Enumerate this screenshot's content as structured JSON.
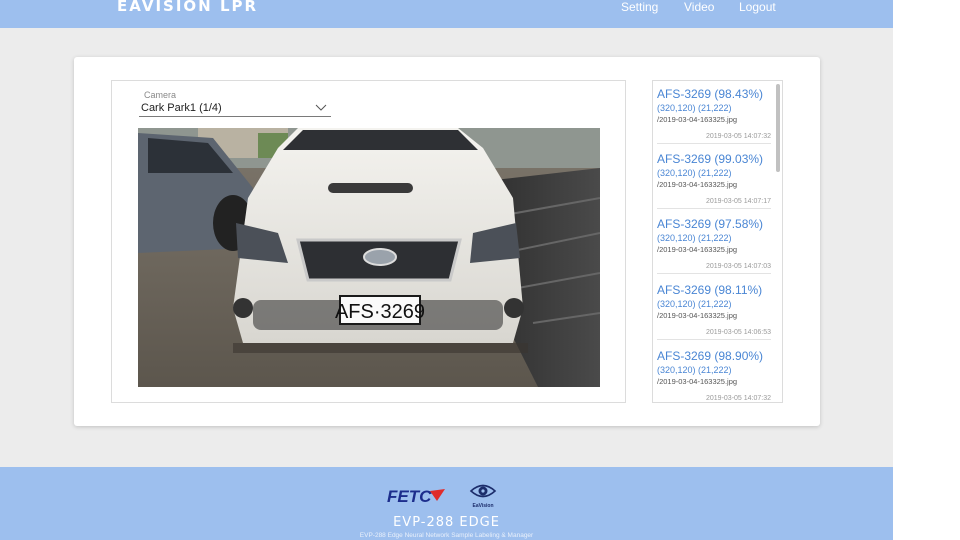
{
  "header": {
    "brand": "EAVISION LPR",
    "nav": [
      {
        "label": "Setting"
      },
      {
        "label": "Video"
      },
      {
        "label": "Logout"
      }
    ]
  },
  "camera": {
    "label": "Camera",
    "selected": "Cark Park1 (1/4)"
  },
  "video": {
    "plate_text": "AFS·3269"
  },
  "results": [
    {
      "plate": "AFS-3269 (98.43%)",
      "coords": "(320,120) (21,222)",
      "file": "/2019-03-04-163325.jpg",
      "timestamp": "2019-03-05 14:07:32"
    },
    {
      "plate": "AFS-3269 (99.03%)",
      "coords": "(320,120) (21,222)",
      "file": "/2019-03-04-163325.jpg",
      "timestamp": "2019-03-05 14:07:17"
    },
    {
      "plate": "AFS-3269 (97.58%)",
      "coords": "(320,120) (21,222)",
      "file": "/2019-03-04-163325.jpg",
      "timestamp": "2019-03-05 14:07:03"
    },
    {
      "plate": "AFS-3269 (98.11%)",
      "coords": "(320,120) (21,222)",
      "file": "/2019-03-04-163325.jpg",
      "timestamp": "2019-03-05 14:06:53"
    },
    {
      "plate": "AFS-3269 (98.90%)",
      "coords": "(320,120) (21,222)",
      "file": "/2019-03-04-163325.jpg",
      "timestamp": "2019-03-05 14:07:32"
    }
  ],
  "footer": {
    "logo_fetc": "FETC",
    "logo_eavision": "EaVision",
    "product": "EVP-288 EDGE",
    "subtitle": "EVP-288 Edge Neural Network Sample Labeling & Manager"
  },
  "colors": {
    "header_bg": "#9dbfee",
    "page_bg": "#ececec",
    "link_blue": "#4a86d4",
    "fetc_blue": "#1c2d8c",
    "fetc_red": "#e02b2b"
  },
  "icons": {
    "select": "chevron-down-icon",
    "footer_eye": "eye-icon"
  }
}
